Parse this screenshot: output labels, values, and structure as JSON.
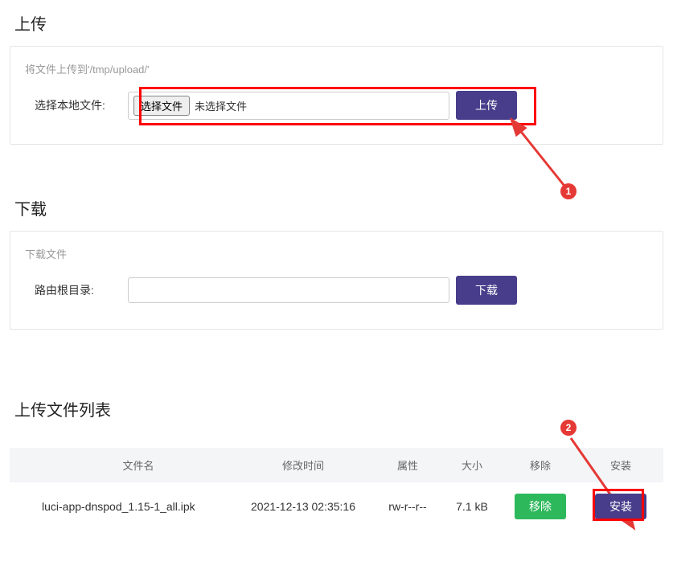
{
  "upload": {
    "title": "上传",
    "desc": "将文件上传到'/tmp/upload/'",
    "label": "选择本地文件:",
    "choose_btn": "选择文件",
    "no_file": "未选择文件",
    "submit": "上传"
  },
  "download": {
    "title": "下载",
    "desc": "下载文件",
    "label": "路由根目录:",
    "input_value": "",
    "submit": "下载"
  },
  "files": {
    "title": "上传文件列表",
    "headers": {
      "name": "文件名",
      "time": "修改时间",
      "attr": "属性",
      "size": "大小",
      "remove": "移除",
      "install": "安装"
    },
    "rows": [
      {
        "name": "luci-app-dnspod_1.15-1_all.ipk",
        "time": "2021-12-13 02:35:16",
        "attr": "rw-r--r--",
        "size": "7.1 kB",
        "remove": "移除",
        "install": "安装"
      }
    ]
  },
  "callouts": {
    "c1": "1",
    "c2": "2"
  }
}
